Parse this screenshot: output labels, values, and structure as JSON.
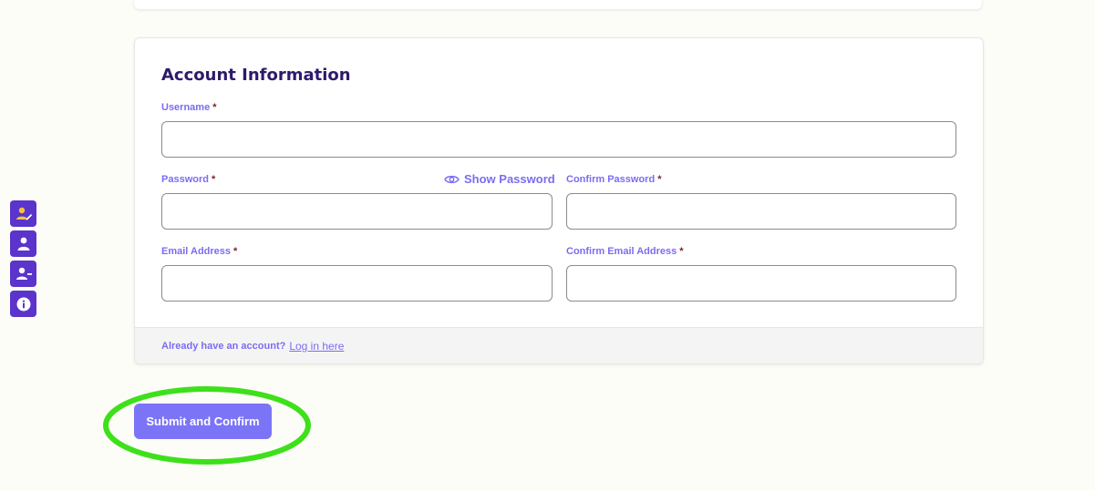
{
  "form": {
    "title": "Account Information",
    "required_marker": "*",
    "fields": {
      "username": {
        "label": "Username",
        "value": ""
      },
      "password": {
        "label": "Password",
        "value": ""
      },
      "confirm_password": {
        "label": "Confirm Password",
        "value": ""
      },
      "email": {
        "label": "Email Address",
        "value": ""
      },
      "confirm_email": {
        "label": "Confirm Email Address",
        "value": ""
      }
    },
    "show_password": {
      "label": "Show Password",
      "icon": "eye-icon"
    },
    "footer": {
      "question": "Already have an account?",
      "link": "Log in here"
    }
  },
  "side_toolbar": {
    "items": [
      {
        "icon": "user-edit-icon"
      },
      {
        "icon": "user-icon"
      },
      {
        "icon": "user-minus-icon"
      },
      {
        "icon": "info-icon"
      }
    ]
  },
  "submit": {
    "label": "Submit and Confirm"
  },
  "colors": {
    "accent": "#7b6cf2",
    "title": "#2e1a6b",
    "required": "#7a1f2b",
    "toolbar": "#5b34cc",
    "toolbar_icon": "#f5c33b",
    "submit_bg": "#7b74f7",
    "highlight": "#3ee01b"
  }
}
